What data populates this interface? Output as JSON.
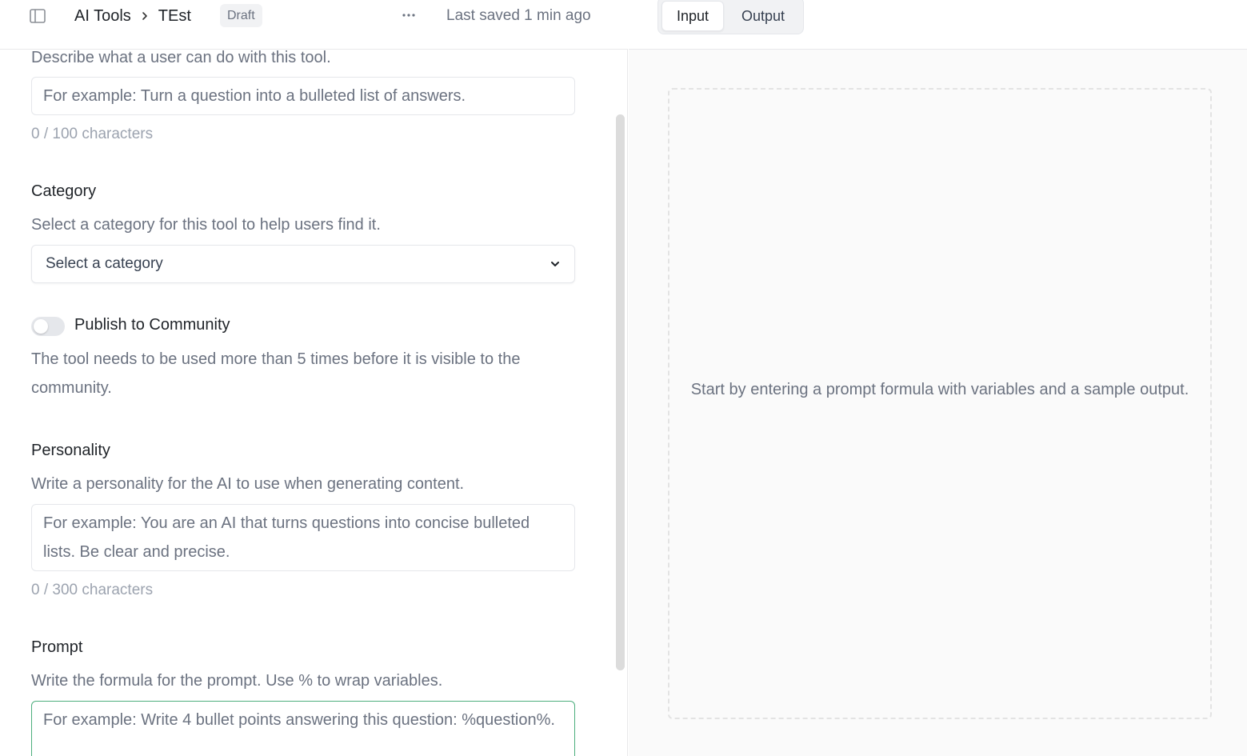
{
  "header": {
    "breadcrumb": {
      "root": "AI Tools",
      "current": "TEst"
    },
    "status_badge": "Draft",
    "more_label": "···",
    "saved_text": "Last saved 1 min ago",
    "icons": {
      "sidebar": "sidebar-toggle-icon",
      "separator": "chevron-right-icon",
      "more": "more-horizontal-icon"
    }
  },
  "tabs": [
    {
      "label": "Input",
      "active": true
    },
    {
      "label": "Output",
      "active": false
    }
  ],
  "form": {
    "description": {
      "help": "Describe what a user can do with this tool.",
      "placeholder": "For example: Turn a question into a bulleted list of answers.",
      "counter": "0 / 100 characters"
    },
    "category": {
      "label": "Category",
      "help": "Select a category for this tool to help users find it.",
      "selected": "Select a category"
    },
    "publish": {
      "label": "Publish to Community",
      "enabled": false,
      "help": "The tool needs to be used more than 5 times before it is visible to the community."
    },
    "personality": {
      "label": "Personality",
      "help": "Write a personality for the AI to use when generating content.",
      "placeholder": "For example: You are an AI that turns questions into concise bulleted lists. Be clear and precise.",
      "counter": "0 / 300 characters"
    },
    "prompt": {
      "label": "Prompt",
      "help": "Write the formula for the prompt. Use % to wrap variables.",
      "placeholder": "For example: Write 4 bullet points answering this question: %question%."
    }
  },
  "preview": {
    "empty_message": "Start by entering a prompt formula with variables and a sample output."
  },
  "colors": {
    "focus_border": "#4cae7d",
    "muted_text": "#6b7280",
    "border": "#e5e7eb",
    "preview_bg": "#fafafa"
  }
}
